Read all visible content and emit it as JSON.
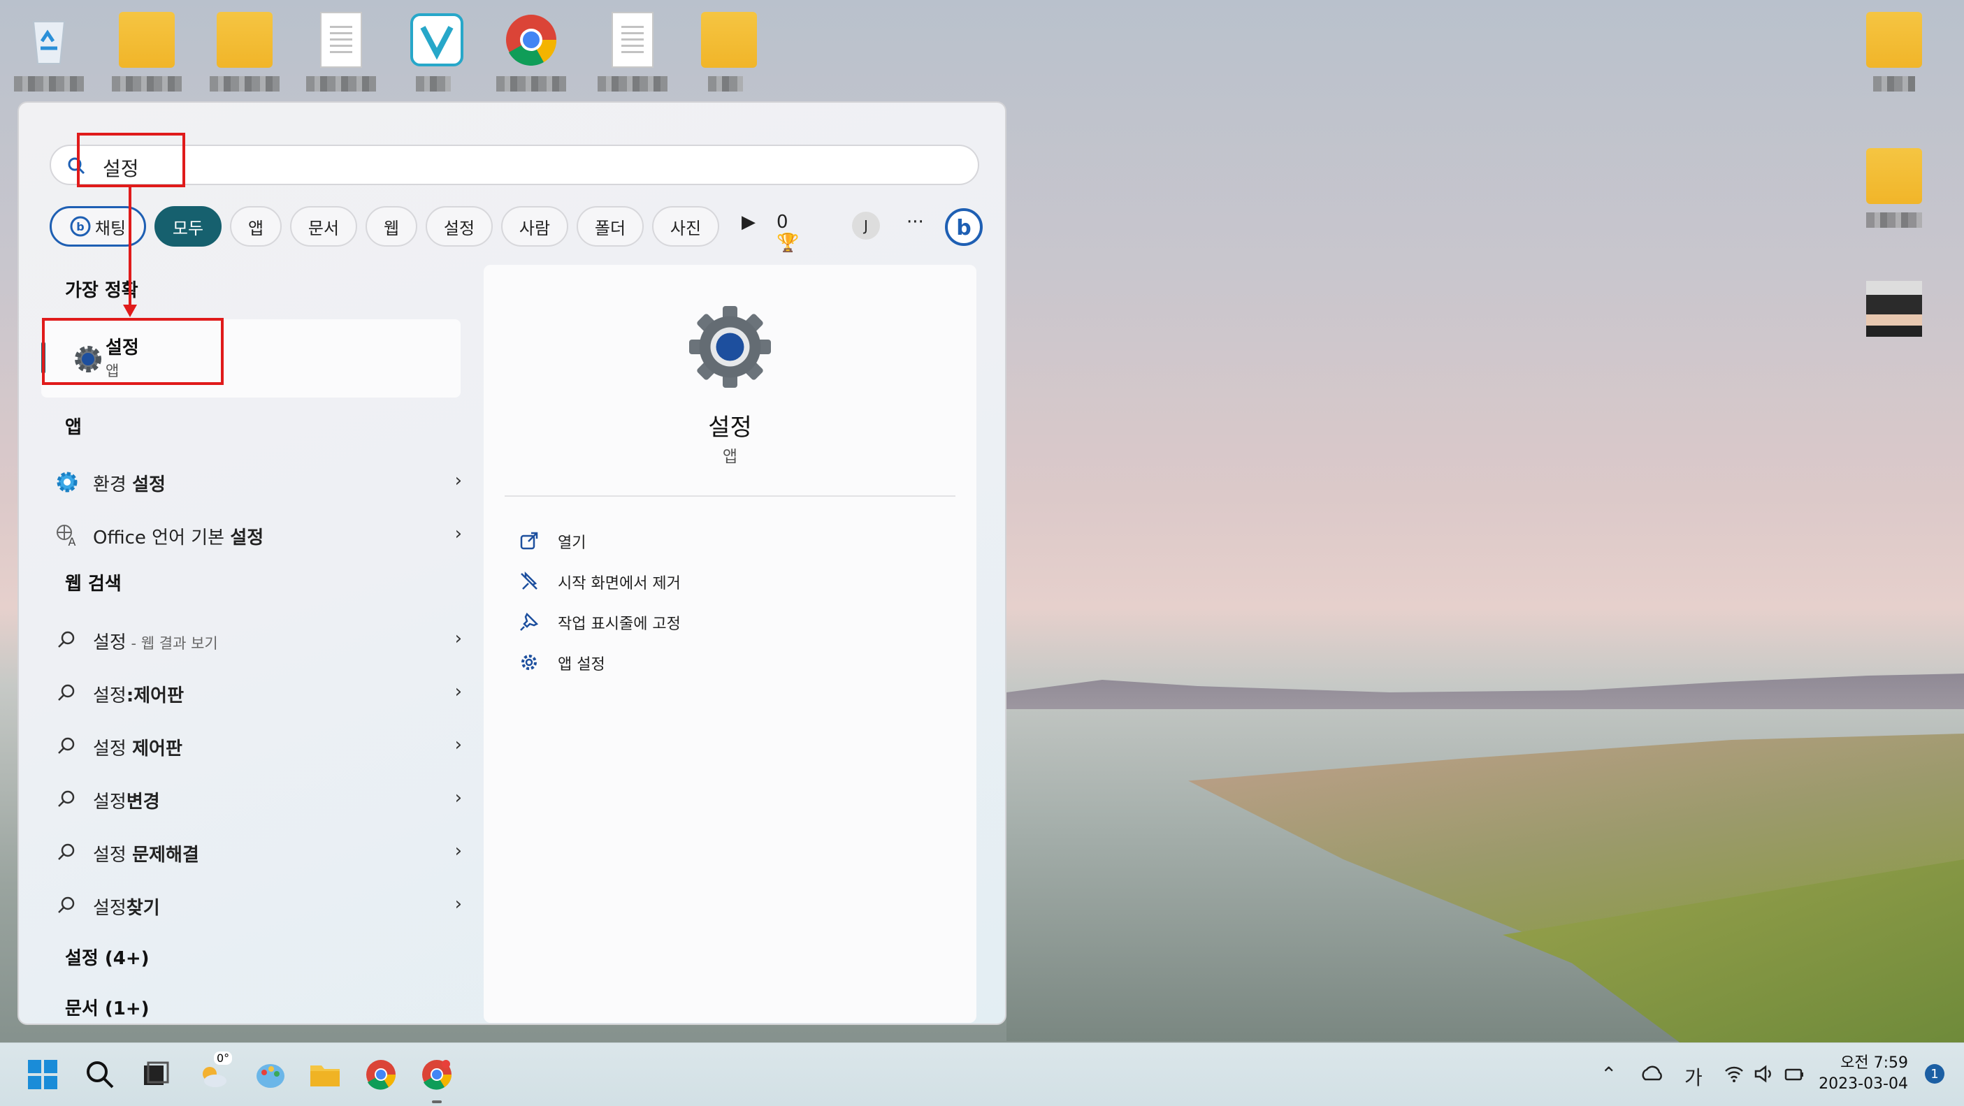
{
  "search": {
    "query": "설정"
  },
  "filters": {
    "chat": "채팅",
    "tabs": [
      "모두",
      "앱",
      "문서",
      "웹",
      "설정",
      "사람",
      "폴더",
      "사진"
    ],
    "points": "0",
    "avatar_letter": "J",
    "more": "···"
  },
  "best_match": {
    "heading": "가장 정확",
    "name": "설정",
    "type": "앱"
  },
  "apps": {
    "heading": "앱",
    "items": [
      {
        "prefix": "환경 ",
        "bold": "설정"
      },
      {
        "prefix": "Office 언어 기본 ",
        "bold": "설정"
      }
    ]
  },
  "web": {
    "heading": "웹 검색",
    "items": [
      {
        "prefix": "설정",
        "bold": "",
        "suffix": " - 웹 결과 보기"
      },
      {
        "prefix": "설정",
        "bold": ":제어판",
        "suffix": ""
      },
      {
        "prefix": "설정 ",
        "bold": "제어판",
        "suffix": ""
      },
      {
        "prefix": "설정",
        "bold": "변경",
        "suffix": ""
      },
      {
        "prefix": "설정 ",
        "bold": "문제해결",
        "suffix": ""
      },
      {
        "prefix": "설정",
        "bold": "찾기",
        "suffix": ""
      }
    ]
  },
  "more_sections": [
    "설정 (4+)",
    "문서 (1+)"
  ],
  "detail": {
    "title": "설정",
    "type": "앱",
    "actions": [
      "열기",
      "시작 화면에서 제거",
      "작업 표시줄에 고정",
      "앱 설정"
    ]
  },
  "taskbar": {
    "weather": "0°",
    "ime": "가",
    "time": "오전 7:59",
    "date": "2023-03-04",
    "notifications": "1"
  },
  "colors": {
    "accent": "#16606e",
    "annotation": "#e01b1b",
    "bing": "#1e5fb3"
  }
}
